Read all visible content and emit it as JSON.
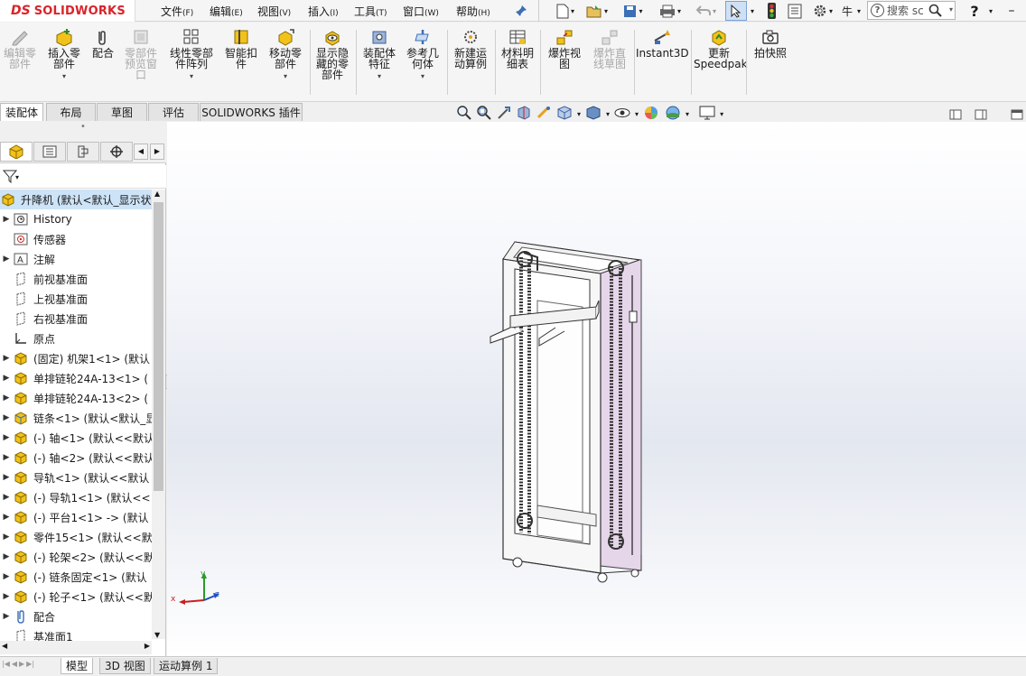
{
  "app": {
    "brand_prefix": "DS",
    "brand_name": "SOLIDWORKS"
  },
  "menu": [
    {
      "label": "文件",
      "key": "(F)"
    },
    {
      "label": "编辑",
      "key": "(E)"
    },
    {
      "label": "视图",
      "key": "(V)"
    },
    {
      "label": "插入",
      "key": "(I)"
    },
    {
      "label": "工具",
      "key": "(T)"
    },
    {
      "label": "窗口",
      "key": "(W)"
    },
    {
      "label": "帮助",
      "key": "(H)"
    }
  ],
  "search": {
    "placeholder": "搜索 sc"
  },
  "top_misc": {
    "part_label": "牛"
  },
  "commands": [
    {
      "line1": "编辑零",
      "line2": "部件",
      "line3": "",
      "disabled": true
    },
    {
      "line1": "插入零",
      "line2": "部件",
      "line3": "",
      "disabled": false
    },
    {
      "line1": "配合",
      "line2": "",
      "line3": "",
      "disabled": false
    },
    {
      "line1": "零部件",
      "line2": "预览窗",
      "line3": "口",
      "disabled": true
    },
    {
      "line1": "线性零部",
      "line2": "件阵列",
      "line3": "",
      "disabled": false
    },
    {
      "line1": "智能扣",
      "line2": "件",
      "line3": "",
      "disabled": false
    },
    {
      "line1": "移动零",
      "line2": "部件",
      "line3": "",
      "disabled": false
    },
    {
      "line1": "显示隐",
      "line2": "藏的零",
      "line3": "部件",
      "disabled": false
    },
    {
      "line1": "装配体",
      "line2": "特征",
      "line3": "",
      "disabled": false
    },
    {
      "line1": "参考几",
      "line2": "何体",
      "line3": "",
      "disabled": false
    },
    {
      "line1": "新建运",
      "line2": "动算例",
      "line3": "",
      "disabled": false
    },
    {
      "line1": "材料明",
      "line2": "细表",
      "line3": "",
      "disabled": false
    },
    {
      "line1": "爆炸视",
      "line2": "图",
      "line3": "",
      "disabled": false
    },
    {
      "line1": "爆炸直",
      "line2": "线草图",
      "line3": "",
      "disabled": true
    },
    {
      "line1": "Instant3D",
      "line2": "",
      "line3": "",
      "disabled": false
    },
    {
      "line1": "更新",
      "line2": "Speedpak",
      "line3": "",
      "disabled": false
    },
    {
      "line1": "拍快照",
      "line2": "",
      "line3": "",
      "disabled": false
    }
  ],
  "cm_tabs": [
    "装配体",
    "布局",
    "草图",
    "评估",
    "SOLIDWORKS 插件"
  ],
  "tree": {
    "root": "升降机  (默认<默认_显示状",
    "items": [
      {
        "label": "History",
        "icon": "history-icon",
        "expandable": true
      },
      {
        "label": "传感器",
        "icon": "sensor-icon",
        "expandable": false
      },
      {
        "label": "注解",
        "icon": "annotation-icon",
        "expandable": true
      },
      {
        "label": "前视基准面",
        "icon": "plane-icon",
        "expandable": false
      },
      {
        "label": "上视基准面",
        "icon": "plane-icon",
        "expandable": false
      },
      {
        "label": "右视基准面",
        "icon": "plane-icon",
        "expandable": false
      },
      {
        "label": "原点",
        "icon": "origin-icon",
        "expandable": false
      },
      {
        "label": "(固定) 机架1<1> (默认",
        "icon": "part-icon",
        "expandable": true
      },
      {
        "label": "单排链轮24A-13<1> (",
        "icon": "part-icon",
        "expandable": true
      },
      {
        "label": "单排链轮24A-13<2> (",
        "icon": "part-icon",
        "expandable": true
      },
      {
        "label": "链条<1> (默认<默认_显",
        "icon": "assembly-icon",
        "expandable": true
      },
      {
        "label": "(-) 轴<1> (默认<<默认",
        "icon": "part-icon",
        "expandable": true
      },
      {
        "label": "(-) 轴<2> (默认<<默认",
        "icon": "part-icon",
        "expandable": true
      },
      {
        "label": "导轨<1> (默认<<默认",
        "icon": "part-icon",
        "expandable": true
      },
      {
        "label": "(-) 导轨1<1> (默认<<",
        "icon": "part-icon",
        "expandable": true
      },
      {
        "label": "(-) 平台1<1> -> (默认",
        "icon": "part-icon",
        "expandable": true
      },
      {
        "label": "零件15<1> (默认<<默",
        "icon": "part-icon",
        "expandable": true
      },
      {
        "label": "(-) 轮架<2> (默认<<默",
        "icon": "part-icon",
        "expandable": true
      },
      {
        "label": "(-) 链条固定<1> (默认",
        "icon": "part-icon",
        "expandable": true
      },
      {
        "label": "(-) 轮子<1> (默认<<默",
        "icon": "part-icon",
        "expandable": true
      },
      {
        "label": "配合",
        "icon": "mate-icon",
        "expandable": true
      },
      {
        "label": "基准面1",
        "icon": "plane-icon",
        "expandable": false
      }
    ]
  },
  "bottom_tabs": [
    "模型",
    "3D 视图",
    "运动算例 1"
  ],
  "triad": {
    "x": "x",
    "y": "y",
    "z": "z"
  },
  "colors": {
    "accent": "#d8242b",
    "selection": "#cde3f7",
    "frame_side": "#e6d6ea",
    "part_yellow": "#f2c21b"
  }
}
